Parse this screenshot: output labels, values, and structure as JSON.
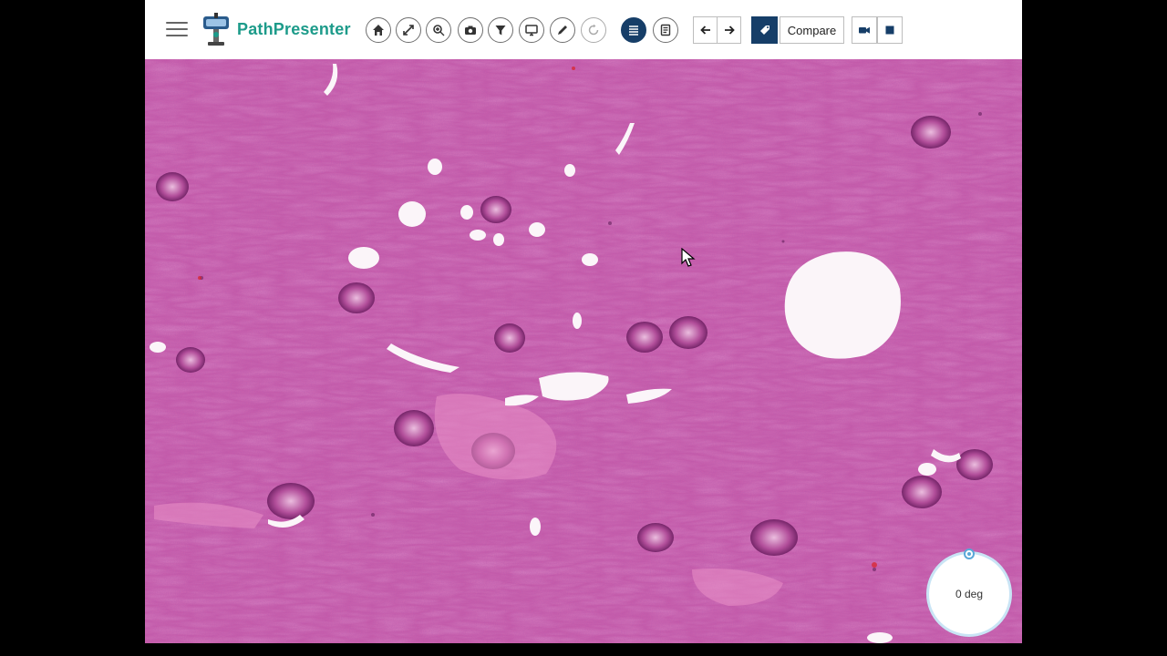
{
  "app": {
    "brand_name": "PathPresenter"
  },
  "toolbar": {
    "compare_label": "Compare",
    "icons": {
      "menu": "hamburger-menu-icon",
      "home": "home-icon",
      "expand": "expand-arrows-icon",
      "zoom": "zoom-icon",
      "snapshot": "camera-icon",
      "filter": "filter-icon",
      "monitor": "monitor-icon",
      "annotate": "pencil-icon",
      "rotate": "rotate-icon",
      "list": "list-icon",
      "report": "document-icon",
      "prev": "arrow-left-icon",
      "next": "arrow-right-icon",
      "tag": "tag-icon",
      "record": "video-camera-icon",
      "stop": "stop-icon"
    }
  },
  "viewer": {
    "rotation_label": "0 deg"
  },
  "colors": {
    "brand": "#1d9b8a",
    "active_button": "#163e68",
    "tissue_stroma": "#c85aa8",
    "tissue_dark": "#8e2f7c",
    "lumen": "#fbf5f9"
  }
}
